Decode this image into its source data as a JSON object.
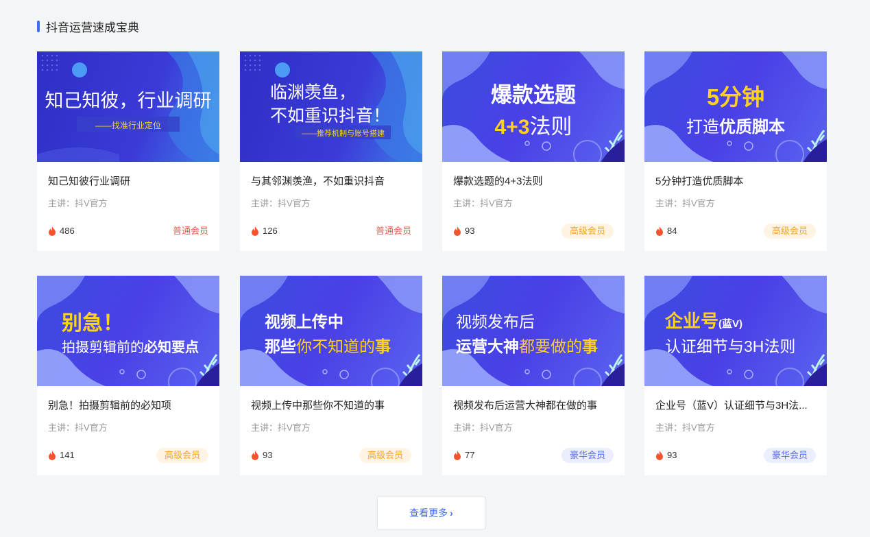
{
  "section": {
    "title": "抖音运营速成宝典"
  },
  "more_button": {
    "label": "查看更多",
    "chevron": "›"
  },
  "colors": {
    "accent": "#3d6df2",
    "flame": "#f5532d",
    "normal": "#f25a4b",
    "senior": "#f5a623",
    "luxury": "#5c6df0"
  },
  "cards": [
    {
      "title": "知己知彼行业调研",
      "lecturer": "主讲：抖V官方",
      "views": "486",
      "badge": "普通会员",
      "banner": {
        "line1": "知己知彼，行业调研",
        "line2": "——找准行业定位"
      }
    },
    {
      "title": "与其邻渊羡渔，不如重识抖音",
      "lecturer": "主讲：抖V官方",
      "views": "126",
      "badge": "普通会员",
      "banner": {
        "line1": "临渊羡鱼，",
        "line2": "不如重识抖音！",
        "line3": "——推荐机制与账号搭建"
      }
    },
    {
      "title": "爆款选题的4+3法则",
      "lecturer": "主讲：抖V官方",
      "views": "93",
      "badge": "高级会员",
      "banner": {
        "line1": "爆款选题",
        "hl": "4+3",
        "line2": "法则"
      }
    },
    {
      "title": "5分钟打造优质脚本",
      "lecturer": "主讲：抖V官方",
      "views": "84",
      "badge": "高级会员",
      "banner": {
        "hl": "5分钟",
        "line1": "打造",
        "line2": "优质脚本"
      }
    },
    {
      "title": "别急！拍摄剪辑前的必知项",
      "lecturer": "主讲：抖V官方",
      "views": "141",
      "badge": "高级会员",
      "banner": {
        "hl": "别急！",
        "line1": "拍摄剪辑前的",
        "line2": "必知要点"
      }
    },
    {
      "title": "视频上传中那些你不知道的事",
      "lecturer": "主讲：抖V官方",
      "views": "93",
      "badge": "高级会员",
      "banner": {
        "line1": "视频上传中",
        "line2a": "那些",
        "line2b": "你不知道的",
        "line2c": "事"
      }
    },
    {
      "title": "视频发布后运营大神都在做的事",
      "lecturer": "主讲：抖V官方",
      "views": "77",
      "badge": "豪华会员",
      "banner": {
        "line1": "视频发布后",
        "line2a": "运营大神",
        "line2b": "都要做的",
        "line2c": "事"
      }
    },
    {
      "title": "企业号（蓝V）认证细节与3H法...",
      "lecturer": "主讲：抖V官方",
      "views": "93",
      "badge": "豪华会员",
      "banner": {
        "hl": "企业号",
        "line1": "(蓝V)",
        "line2": "认证细节与3H法则"
      }
    }
  ]
}
